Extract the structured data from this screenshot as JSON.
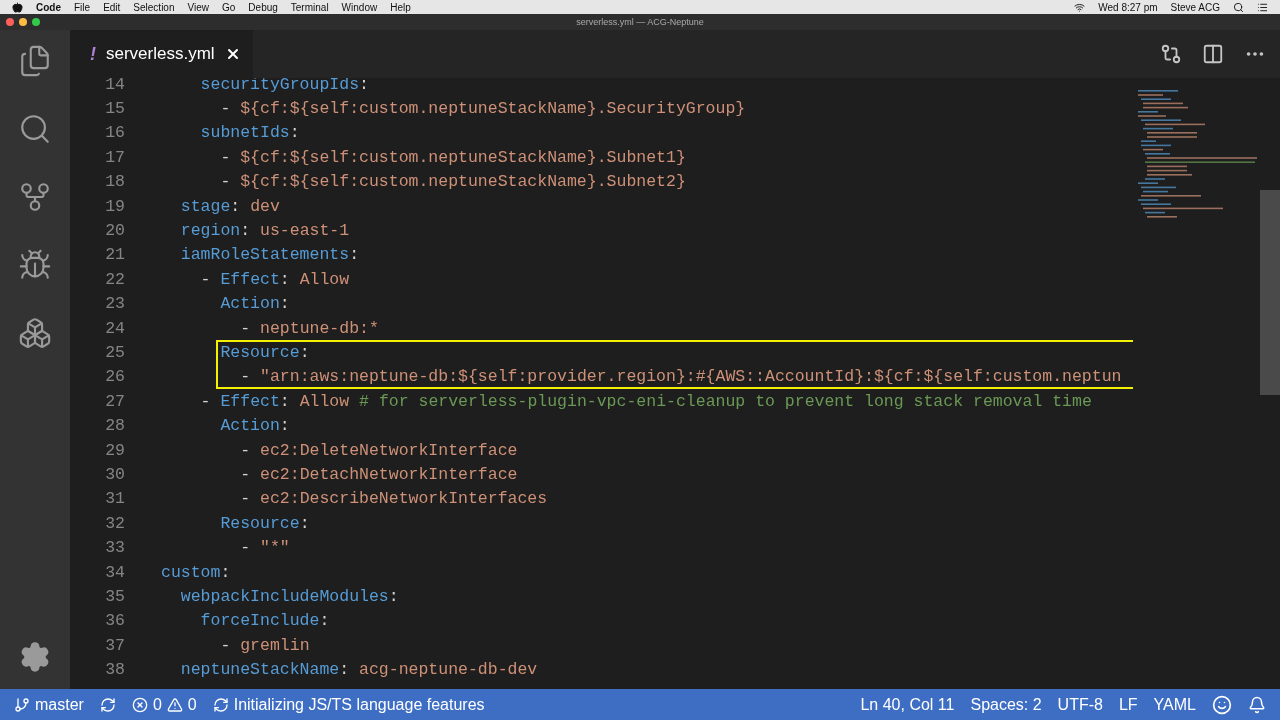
{
  "menu_bar": {
    "app": "Code",
    "items": [
      "File",
      "Edit",
      "Selection",
      "View",
      "Go",
      "Debug",
      "Terminal",
      "Window",
      "Help"
    ],
    "clock": "Wed 8:27 pm",
    "user": "Steve ACG"
  },
  "window": {
    "title": "serverless.yml — ACG-Neptune"
  },
  "tabs": [
    {
      "marker": "!",
      "label": "serverless.yml",
      "selected": true
    }
  ],
  "editor": {
    "lines": [
      {
        "number": "14",
        "highlight": false,
        "tokens": [
          {
            "kind": "key",
            "text": "    securityGroupIds"
          },
          {
            "kind": "punct",
            "text": ":"
          }
        ]
      },
      {
        "number": "15",
        "highlight": false,
        "tokens": [
          {
            "kind": "punct",
            "text": "      - "
          },
          {
            "kind": "value",
            "text": "${cf:${self:custom.neptuneStackName}.SecurityGroup}"
          }
        ]
      },
      {
        "number": "16",
        "highlight": false,
        "tokens": [
          {
            "kind": "key",
            "text": "    subnetIds"
          },
          {
            "kind": "punct",
            "text": ":"
          }
        ]
      },
      {
        "number": "17",
        "highlight": false,
        "tokens": [
          {
            "kind": "punct",
            "text": "      - "
          },
          {
            "kind": "value",
            "text": "${cf:${self:custom.neptuneStackName}.Subnet1}"
          }
        ]
      },
      {
        "number": "18",
        "highlight": false,
        "tokens": [
          {
            "kind": "punct",
            "text": "      - "
          },
          {
            "kind": "value",
            "text": "${cf:${self:custom.neptuneStackName}.Subnet2}"
          }
        ]
      },
      {
        "number": "19",
        "highlight": false,
        "tokens": [
          {
            "kind": "key",
            "text": "  stage"
          },
          {
            "kind": "punct",
            "text": ": "
          },
          {
            "kind": "value",
            "text": "dev"
          }
        ]
      },
      {
        "number": "20",
        "highlight": false,
        "tokens": [
          {
            "kind": "key",
            "text": "  region"
          },
          {
            "kind": "punct",
            "text": ": "
          },
          {
            "kind": "value",
            "text": "us-east-1"
          }
        ]
      },
      {
        "number": "21",
        "highlight": false,
        "tokens": [
          {
            "kind": "key",
            "text": "  iamRoleStatements"
          },
          {
            "kind": "punct",
            "text": ":"
          }
        ]
      },
      {
        "number": "22",
        "highlight": false,
        "tokens": [
          {
            "kind": "punct",
            "text": "    - "
          },
          {
            "kind": "key",
            "text": "Effect"
          },
          {
            "kind": "punct",
            "text": ": "
          },
          {
            "kind": "value",
            "text": "Allow"
          }
        ]
      },
      {
        "number": "23",
        "highlight": false,
        "tokens": [
          {
            "kind": "key",
            "text": "      Action"
          },
          {
            "kind": "punct",
            "text": ":"
          }
        ]
      },
      {
        "number": "24",
        "highlight": false,
        "tokens": [
          {
            "kind": "punct",
            "text": "        - "
          },
          {
            "kind": "value",
            "text": "neptune-db:*"
          }
        ]
      },
      {
        "number": "25",
        "highlight": true,
        "tokens": [
          {
            "kind": "key",
            "text": "      Resource"
          },
          {
            "kind": "punct",
            "text": ":"
          }
        ]
      },
      {
        "number": "26",
        "highlight": true,
        "tokens": [
          {
            "kind": "punct",
            "text": "        - "
          },
          {
            "kind": "value",
            "text": "\"arn:aws:neptune-db:${self:provider.region}:#{AWS::AccountId}:${cf:${self:custom.neptun"
          }
        ]
      },
      {
        "number": "27",
        "highlight": false,
        "tokens": [
          {
            "kind": "punct",
            "text": "    - "
          },
          {
            "kind": "key",
            "text": "Effect"
          },
          {
            "kind": "punct",
            "text": ": "
          },
          {
            "kind": "value",
            "text": "Allow "
          },
          {
            "kind": "comment",
            "text": "# for serverless-plugin-vpc-eni-cleanup to prevent long stack removal time"
          }
        ]
      },
      {
        "number": "28",
        "highlight": false,
        "tokens": [
          {
            "kind": "key",
            "text": "      Action"
          },
          {
            "kind": "punct",
            "text": ":"
          }
        ]
      },
      {
        "number": "29",
        "highlight": false,
        "tokens": [
          {
            "kind": "punct",
            "text": "        - "
          },
          {
            "kind": "value",
            "text": "ec2:DeleteNetworkInterface"
          }
        ]
      },
      {
        "number": "30",
        "highlight": false,
        "tokens": [
          {
            "kind": "punct",
            "text": "        - "
          },
          {
            "kind": "value",
            "text": "ec2:DetachNetworkInterface"
          }
        ]
      },
      {
        "number": "31",
        "highlight": false,
        "tokens": [
          {
            "kind": "punct",
            "text": "        - "
          },
          {
            "kind": "value",
            "text": "ec2:DescribeNetworkInterfaces"
          }
        ]
      },
      {
        "number": "32",
        "highlight": false,
        "tokens": [
          {
            "kind": "key",
            "text": "      Resource"
          },
          {
            "kind": "punct",
            "text": ":"
          }
        ]
      },
      {
        "number": "33",
        "highlight": false,
        "tokens": [
          {
            "kind": "punct",
            "text": "        - "
          },
          {
            "kind": "value",
            "text": "\"*\""
          }
        ]
      },
      {
        "number": "34",
        "highlight": false,
        "tokens": [
          {
            "kind": "key",
            "text": "custom"
          },
          {
            "kind": "punct",
            "text": ":"
          }
        ]
      },
      {
        "number": "35",
        "highlight": false,
        "tokens": [
          {
            "kind": "key",
            "text": "  webpackIncludeModules"
          },
          {
            "kind": "punct",
            "text": ":"
          }
        ]
      },
      {
        "number": "36",
        "highlight": false,
        "tokens": [
          {
            "kind": "key",
            "text": "    forceInclude"
          },
          {
            "kind": "punct",
            "text": ":"
          }
        ]
      },
      {
        "number": "37",
        "highlight": false,
        "tokens": [
          {
            "kind": "punct",
            "text": "      - "
          },
          {
            "kind": "value",
            "text": "gremlin"
          }
        ]
      },
      {
        "number": "38",
        "highlight": false,
        "tokens": [
          {
            "kind": "key",
            "text": "  neptuneStackName"
          },
          {
            "kind": "punct",
            "text": ": "
          },
          {
            "kind": "value",
            "text": "acg-neptune-db-dev"
          }
        ]
      }
    ]
  },
  "status_bar": {
    "branch": "master",
    "errors": "0",
    "warnings": "0",
    "task": "Initializing JS/TS language features",
    "position": "Ln 40, Col 11",
    "indent": "Spaces: 2",
    "encoding": "UTF-8",
    "eol": "LF",
    "language": "YAML"
  }
}
